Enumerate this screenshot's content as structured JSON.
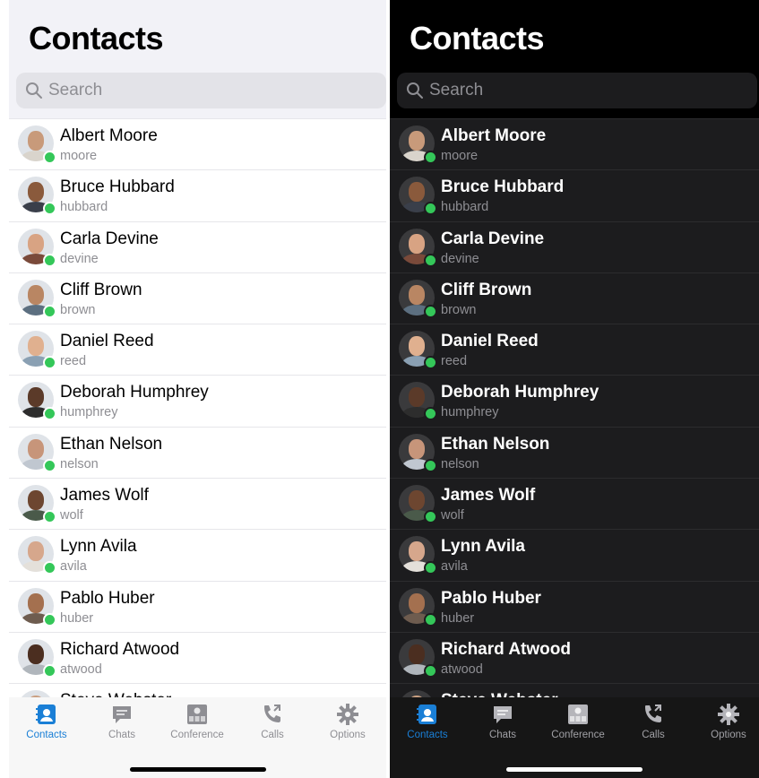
{
  "light": {
    "title": "Contacts",
    "search": {
      "placeholder": "Search",
      "icon": "search-icon"
    },
    "contacts": [
      {
        "name": "Albert Moore",
        "username": "moore",
        "status": "online"
      },
      {
        "name": "Bruce Hubbard",
        "username": "hubbard",
        "status": "online"
      },
      {
        "name": "Carla Devine",
        "username": "devine",
        "status": "online"
      },
      {
        "name": "Cliff Brown",
        "username": "brown",
        "status": "online"
      },
      {
        "name": "Daniel Reed",
        "username": "reed",
        "status": "online"
      },
      {
        "name": "Deborah Humphrey",
        "username": "humphrey",
        "status": "online"
      },
      {
        "name": "Ethan Nelson",
        "username": "nelson",
        "status": "online"
      },
      {
        "name": "James Wolf",
        "username": "wolf",
        "status": "online"
      },
      {
        "name": "Lynn Avila",
        "username": "avila",
        "status": "online"
      },
      {
        "name": "Pablo Huber",
        "username": "huber",
        "status": "online"
      },
      {
        "name": "Richard Atwood",
        "username": "atwood",
        "status": "online"
      },
      {
        "name": "Steve Webster",
        "username": "",
        "status": ""
      }
    ],
    "tabs": [
      {
        "label": "Contacts",
        "icon": "contacts-icon",
        "active": true
      },
      {
        "label": "Chats",
        "icon": "chat-bubble-icon",
        "active": false
      },
      {
        "label": "Conference",
        "icon": "conference-icon",
        "active": false
      },
      {
        "label": "Calls",
        "icon": "phone-call-icon",
        "active": false
      },
      {
        "label": "Options",
        "icon": "gear-icon",
        "active": false
      }
    ]
  },
  "dark": {
    "title": "Contacts",
    "search": {
      "placeholder": "Search",
      "icon": "search-icon"
    },
    "contacts": [
      {
        "name": "Albert Moore",
        "username": "moore",
        "status": "online"
      },
      {
        "name": "Bruce Hubbard",
        "username": "hubbard",
        "status": "online"
      },
      {
        "name": "Carla Devine",
        "username": "devine",
        "status": "online"
      },
      {
        "name": "Cliff Brown",
        "username": "brown",
        "status": "online"
      },
      {
        "name": "Daniel Reed",
        "username": "reed",
        "status": "online"
      },
      {
        "name": "Deborah Humphrey",
        "username": "humphrey",
        "status": "online"
      },
      {
        "name": "Ethan Nelson",
        "username": "nelson",
        "status": "online"
      },
      {
        "name": "James Wolf",
        "username": "wolf",
        "status": "online"
      },
      {
        "name": "Lynn Avila",
        "username": "avila",
        "status": "online"
      },
      {
        "name": "Pablo Huber",
        "username": "huber",
        "status": "online"
      },
      {
        "name": "Richard Atwood",
        "username": "atwood",
        "status": "online"
      },
      {
        "name": "Steve Webster",
        "username": "",
        "status": ""
      }
    ],
    "tabs": [
      {
        "label": "Contacts",
        "icon": "contacts-icon",
        "active": true
      },
      {
        "label": "Chats",
        "icon": "chat-bubble-icon",
        "active": false
      },
      {
        "label": "Conference",
        "icon": "conference-icon",
        "active": false
      },
      {
        "label": "Calls",
        "icon": "phone-call-icon",
        "active": false
      },
      {
        "label": "Options",
        "icon": "gear-icon",
        "active": false
      }
    ]
  },
  "colors": {
    "accent": "#1a7fd6",
    "online": "#34c759",
    "inactive_tab": "#8e8e93"
  }
}
